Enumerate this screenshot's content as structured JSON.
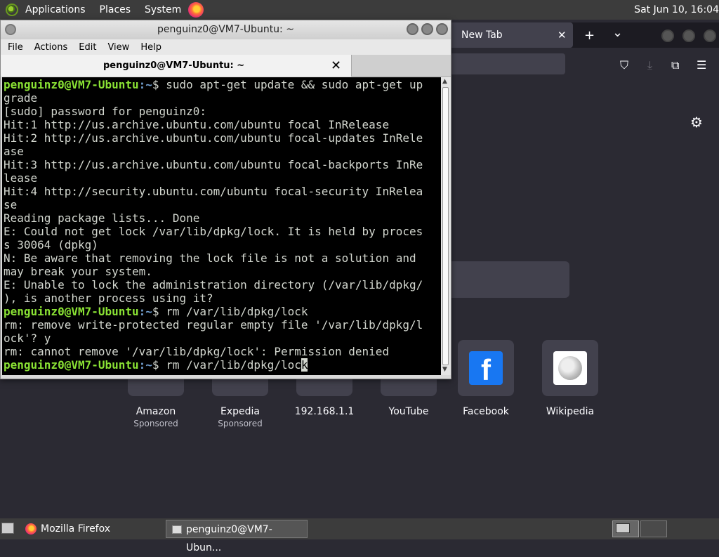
{
  "top_panel": {
    "menus": [
      "Applications",
      "Places",
      "System"
    ],
    "clock": "Sat Jun 10, 16:04"
  },
  "firefox": {
    "tab_title": "New Tab",
    "tab_close": "✕",
    "new_tab": "+",
    "tab_list": "⌄",
    "top_sites": [
      {
        "name": "Amazon",
        "sponsored": "Sponsored"
      },
      {
        "name": "Expedia",
        "sponsored": "Sponsored"
      },
      {
        "name": "192.168.1.1",
        "sponsored": ""
      },
      {
        "name": "YouTube",
        "sponsored": ""
      },
      {
        "name": "Facebook",
        "sponsored": ""
      },
      {
        "name": "Wikipedia",
        "sponsored": ""
      }
    ]
  },
  "terminal": {
    "window_title": "penguinz0@VM7-Ubuntu: ~",
    "menu": [
      "File",
      "Actions",
      "Edit",
      "View",
      "Help"
    ],
    "tab_title": "penguinz0@VM7-Ubuntu: ~",
    "tab_close": "✕",
    "prompt_user": "penguinz0@VM7-Ubuntu",
    "prompt_path": ":~",
    "prompt_symbol": "$ ",
    "cmd1_a": "sudo apt-get update && sudo apt-get up",
    "cmd1_b": "grade",
    "out": [
      "[sudo] password for penguinz0:",
      "Hit:1 http://us.archive.ubuntu.com/ubuntu focal InRelease",
      "Hit:2 http://us.archive.ubuntu.com/ubuntu focal-updates InRele",
      "ase",
      "Hit:3 http://us.archive.ubuntu.com/ubuntu focal-backports InRe",
      "lease",
      "Hit:4 http://security.ubuntu.com/ubuntu focal-security InRelea",
      "se",
      "Reading package lists... Done",
      "E: Could not get lock /var/lib/dpkg/lock. It is held by proces",
      "s 30064 (dpkg)",
      "N: Be aware that removing the lock file is not a solution and",
      "may break your system.",
      "E: Unable to lock the administration directory (/var/lib/dpkg/",
      "), is another process using it?"
    ],
    "cmd2": "rm /var/lib/dpkg/lock",
    "out2": [
      "rm: remove write-protected regular empty file '/var/lib/dpkg/l",
      "ock'? y",
      "rm: cannot remove '/var/lib/dpkg/lock': Permission denied"
    ],
    "cmd3": "rm /var/lib/dpkg/loc",
    "cursor_char": "k"
  },
  "taskbar": {
    "firefox_label": "Mozilla Firefox",
    "terminal_label": "penguinz0@VM7-Ubun..."
  }
}
